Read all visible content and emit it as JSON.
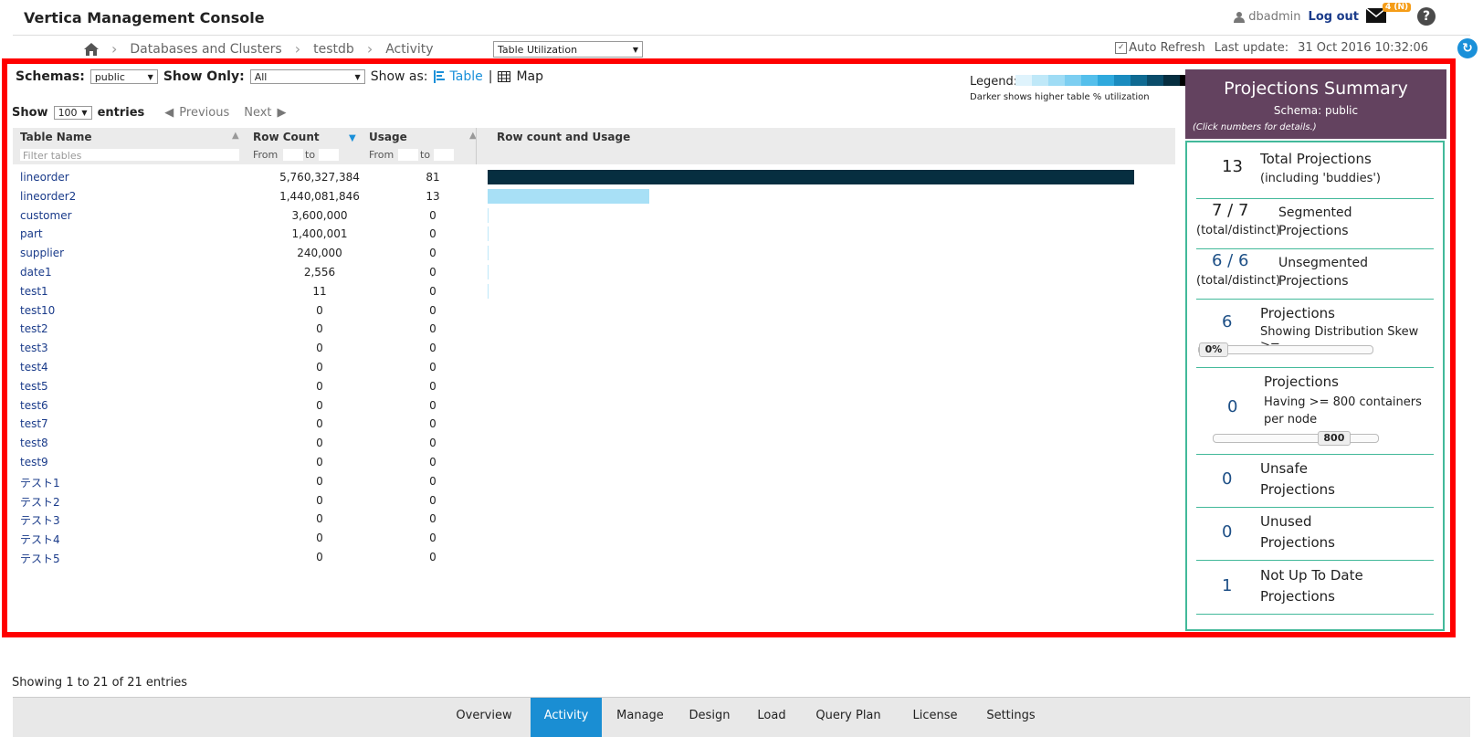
{
  "header": {
    "title": "Vertica Management Console",
    "user": "dbadmin",
    "logout": "Log out",
    "mail_badge": "4 (N)",
    "help": "?"
  },
  "breadcrumb": {
    "items": [
      "Databases and Clusters",
      "testdb",
      "Activity"
    ],
    "view_select": "Table Utilization"
  },
  "refresh": {
    "auto_refresh_label": "Auto Refresh",
    "last_update_label": "Last update:",
    "last_update_value": "31 Oct 2016 10:32:06"
  },
  "controls": {
    "schemas_label": "Schemas:",
    "schemas_value": "public",
    "show_only_label": "Show Only:",
    "show_only_value": "All",
    "show_as_label": "Show as:",
    "table_link": "Table",
    "sep": "|",
    "map_link": "Map"
  },
  "legend": {
    "label": "Legend:",
    "note": "Darker shows higher table % utilization",
    "colors": [
      "#dff3fc",
      "#bfe8f8",
      "#9fdcf5",
      "#7ccef1",
      "#55bfeb",
      "#2fa9dd",
      "#1a8bbf",
      "#0f6a92",
      "#0a4c6a",
      "#062e40",
      "#000000"
    ]
  },
  "pager": {
    "show_label": "Show",
    "page_size": "100",
    "entries_label": "entries",
    "previous": "Previous",
    "next": "Next"
  },
  "table": {
    "columns": {
      "name": "Table Name",
      "row_count": "Row Count",
      "usage": "Usage",
      "bar": "Row count and Usage"
    },
    "filter_placeholder": "Filter tables",
    "from": "From",
    "to": "to",
    "max_rows": 5760327384,
    "rows": [
      {
        "name": "lineorder",
        "row_count": "5,760,327,384",
        "usage": "81",
        "rows_num": 5760327384,
        "color": "#062e40"
      },
      {
        "name": "lineorder2",
        "row_count": "1,440,081,846",
        "usage": "13",
        "rows_num": 1440081846,
        "color": "#a8e0f6"
      },
      {
        "name": "customer",
        "row_count": "3,600,000",
        "usage": "0",
        "rows_num": 3600000,
        "color": "#bfe8f8"
      },
      {
        "name": "part",
        "row_count": "1,400,001",
        "usage": "0",
        "rows_num": 1400001,
        "color": "#bfe8f8"
      },
      {
        "name": "supplier",
        "row_count": "240,000",
        "usage": "0",
        "rows_num": 240000,
        "color": "#bfe8f8"
      },
      {
        "name": "date1",
        "row_count": "2,556",
        "usage": "0",
        "rows_num": 2556,
        "color": "#bfe8f8"
      },
      {
        "name": "test1",
        "row_count": "11",
        "usage": "0",
        "rows_num": 11,
        "color": "#bfe8f8"
      },
      {
        "name": "test10",
        "row_count": "0",
        "usage": "0",
        "rows_num": 0,
        "color": "#bfe8f8"
      },
      {
        "name": "test2",
        "row_count": "0",
        "usage": "0",
        "rows_num": 0,
        "color": "#bfe8f8"
      },
      {
        "name": "test3",
        "row_count": "0",
        "usage": "0",
        "rows_num": 0,
        "color": "#bfe8f8"
      },
      {
        "name": "test4",
        "row_count": "0",
        "usage": "0",
        "rows_num": 0,
        "color": "#bfe8f8"
      },
      {
        "name": "test5",
        "row_count": "0",
        "usage": "0",
        "rows_num": 0,
        "color": "#bfe8f8"
      },
      {
        "name": "test6",
        "row_count": "0",
        "usage": "0",
        "rows_num": 0,
        "color": "#bfe8f8"
      },
      {
        "name": "test7",
        "row_count": "0",
        "usage": "0",
        "rows_num": 0,
        "color": "#bfe8f8"
      },
      {
        "name": "test8",
        "row_count": "0",
        "usage": "0",
        "rows_num": 0,
        "color": "#bfe8f8"
      },
      {
        "name": "test9",
        "row_count": "0",
        "usage": "0",
        "rows_num": 0,
        "color": "#bfe8f8"
      },
      {
        "name": "テスト1",
        "row_count": "0",
        "usage": "0",
        "rows_num": 0,
        "color": "#bfe8f8"
      },
      {
        "name": "テスト2",
        "row_count": "0",
        "usage": "0",
        "rows_num": 0,
        "color": "#bfe8f8"
      },
      {
        "name": "テスト3",
        "row_count": "0",
        "usage": "0",
        "rows_num": 0,
        "color": "#bfe8f8"
      },
      {
        "name": "テスト4",
        "row_count": "0",
        "usage": "0",
        "rows_num": 0,
        "color": "#bfe8f8"
      },
      {
        "name": "テスト5",
        "row_count": "0",
        "usage": "0",
        "rows_num": 0,
        "color": "#bfe8f8"
      }
    ]
  },
  "summary": {
    "title": "Projections Summary",
    "schema": "Schema: public",
    "note": "(Click numbers for details.)",
    "total": {
      "num": "13",
      "title": "Total Projections",
      "sub": "(including 'buddies')"
    },
    "segmented": {
      "num": "7 / 7",
      "sub": "(total/distinct)",
      "title": "Segmented",
      "title2": "Projections"
    },
    "unsegmented": {
      "num": "6 / 6",
      "sub": "(total/distinct)",
      "title": "Unsegmented",
      "title2": "Projections"
    },
    "skew": {
      "num": "6",
      "title": "Projections",
      "sub": "Showing Distribution Skew >=",
      "slider_value": "0%",
      "slider_fraction": 0
    },
    "containers": {
      "num": "0",
      "title": "Projections",
      "sub": "Having >= 800 containers per node",
      "slider_value": "800",
      "slider_fraction": 0.78
    },
    "unsafe": {
      "num": "0",
      "title": "Unsafe",
      "title2": "Projections"
    },
    "unused": {
      "num": "0",
      "title": "Unused",
      "title2": "Projections"
    },
    "outdated": {
      "num": "1",
      "title": "Not Up To Date",
      "title2": "Projections"
    }
  },
  "footer": {
    "showing": "Showing 1 to 21 of 21 entries",
    "tabs": [
      "Overview",
      "Activity",
      "Manage",
      "Design",
      "Load",
      "Query Plan",
      "License",
      "Settings"
    ],
    "active_tab": "Activity"
  },
  "colors": {
    "highlight": "#ff0000",
    "summary_header": "#63425f",
    "summary_border": "#42b99a",
    "active_tab": "#1a8ed3"
  }
}
